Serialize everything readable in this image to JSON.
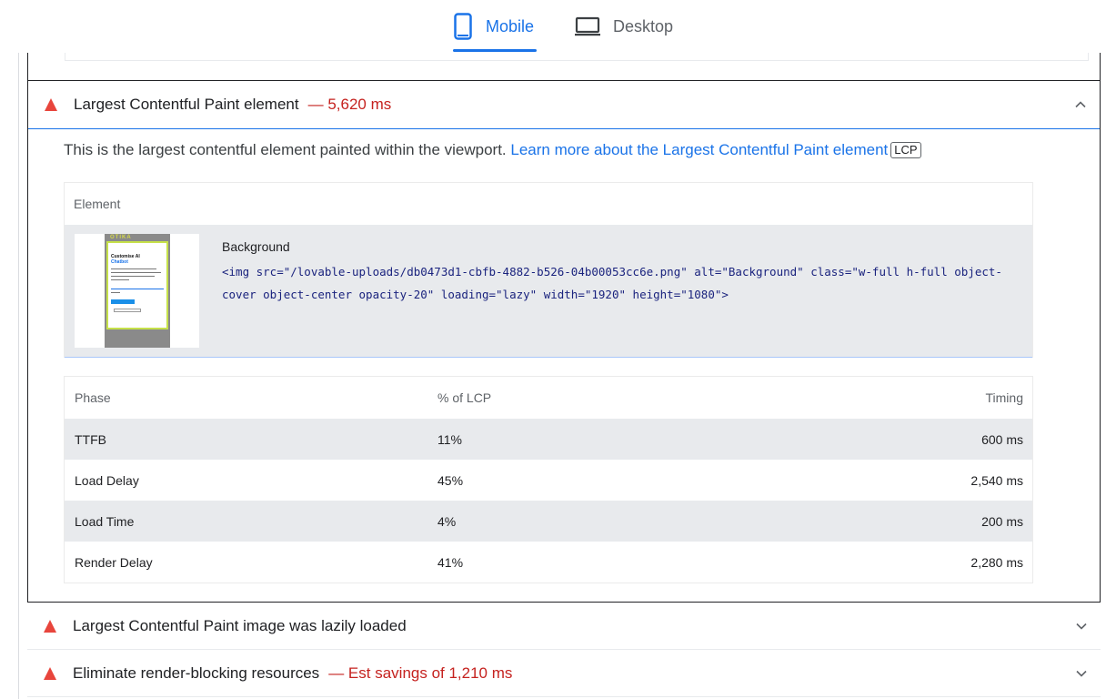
{
  "tabs": {
    "mobile_label": "Mobile",
    "desktop_label": "Desktop",
    "active": "Mobile"
  },
  "colors": {
    "accent": "#1a73e8",
    "fail": "#e8453c",
    "fail_text": "#c5221f"
  },
  "lcp_audit": {
    "title": "Largest Contentful Paint element",
    "separator": "—",
    "value": "5,620 ms",
    "expanded": true,
    "description": "This is the largest contentful element painted within the viewport.",
    "learn_more_link": "Learn more about the Largest Contentful Paint element",
    "badge": "LCP",
    "element_header": "Element",
    "element": {
      "label": "Background",
      "snippet": "<img src=\"/lovable-uploads/db0473d1-cbfb-4882-b526-04b00053cc6e.png\" alt=\"Background\" class=\"w-full h-full object-cover object-center opacity-20\" loading=\"lazy\" width=\"1920\" height=\"1080\">",
      "thumbnail_brand": "OTIKA",
      "thumbnail_heading": "Customise AI",
      "thumbnail_subheading": "Chatbot"
    },
    "phase_table": {
      "headers": [
        "Phase",
        "% of LCP",
        "Timing"
      ],
      "rows": [
        {
          "phase": "TTFB",
          "percent": "11%",
          "timing": "600 ms"
        },
        {
          "phase": "Load Delay",
          "percent": "45%",
          "timing": "2,540 ms"
        },
        {
          "phase": "Load Time",
          "percent": "4%",
          "timing": "200 ms"
        },
        {
          "phase": "Render Delay",
          "percent": "41%",
          "timing": "2,280 ms"
        }
      ]
    }
  },
  "other_audits": [
    {
      "title": "Largest Contentful Paint image was lazily loaded",
      "value": ""
    },
    {
      "title": "Eliminate render-blocking resources",
      "separator": "—",
      "value": "Est savings of 1,210 ms"
    }
  ]
}
